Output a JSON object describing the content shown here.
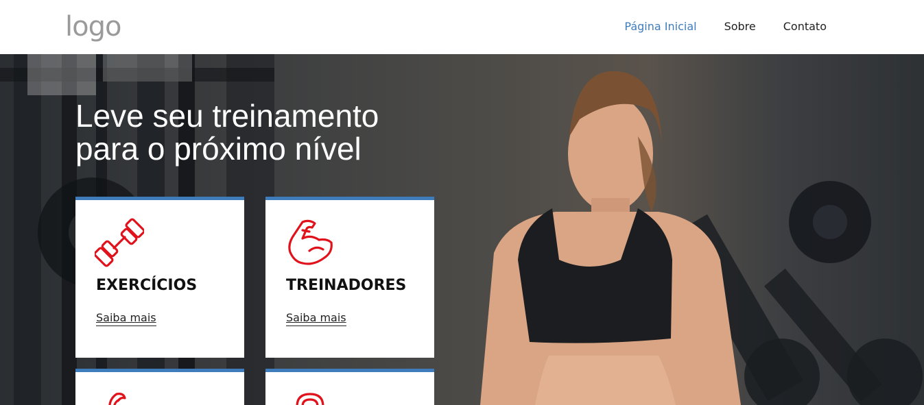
{
  "header": {
    "logo": "logo",
    "nav": [
      {
        "label": "Página Inicial",
        "active": true
      },
      {
        "label": "Sobre",
        "active": false
      },
      {
        "label": "Contato",
        "active": false
      }
    ]
  },
  "hero": {
    "title_line1": "Leve seu treinamento",
    "title_line2": "para o próximo nível"
  },
  "cards": [
    {
      "title": "EXERCÍCIOS",
      "link": "Saiba mais",
      "icon": "dumbbell-icon"
    },
    {
      "title": "TREINADORES",
      "link": "Saiba mais",
      "icon": "flexed-arm-icon"
    },
    {
      "title": "",
      "link": "",
      "icon": "ribbon-icon"
    },
    {
      "title": "",
      "link": "",
      "icon": "kettlebell-icon"
    }
  ],
  "colors": {
    "accent": "#3f7cbc",
    "icon_red": "#e0121c"
  }
}
